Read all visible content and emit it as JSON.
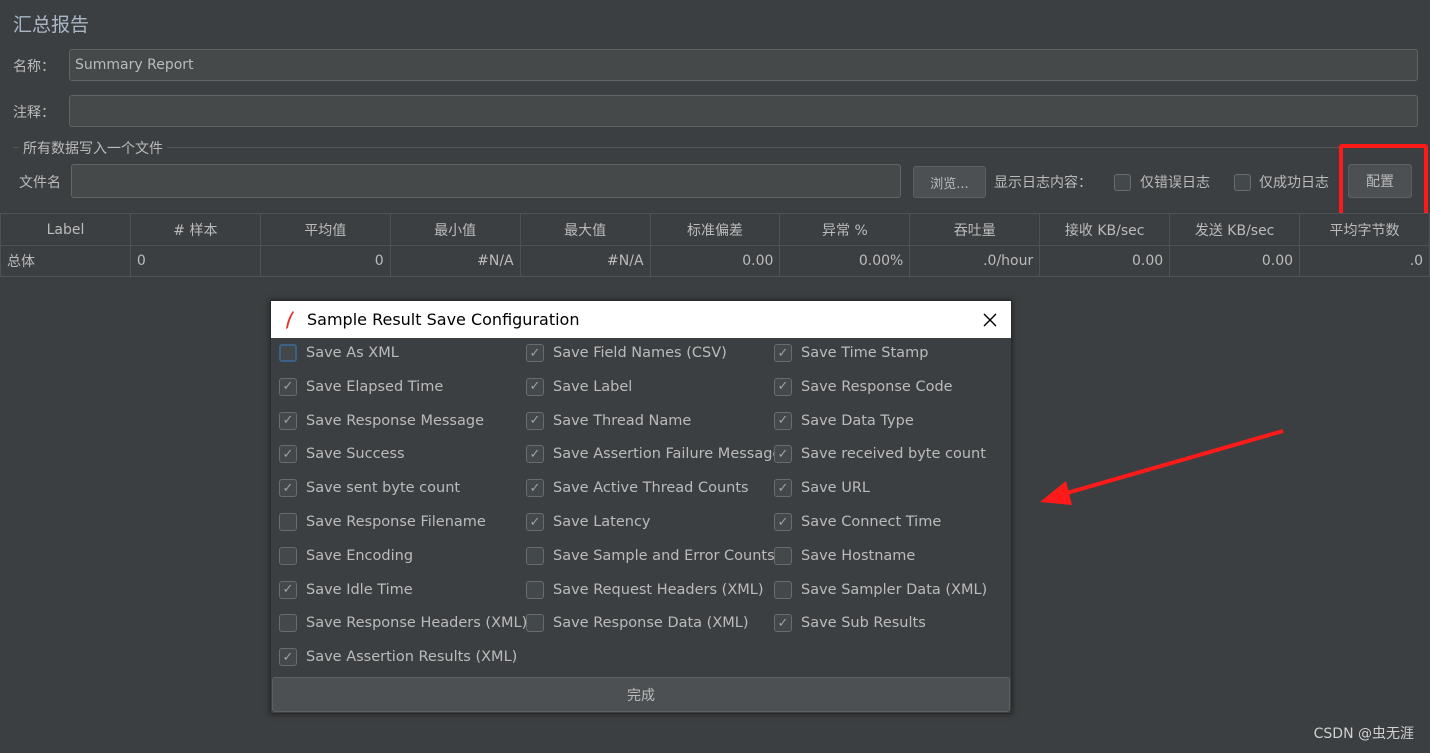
{
  "header": {
    "title": "汇总报告",
    "name_label": "名称：",
    "name_value": "Summary Report",
    "comment_label": "注释：",
    "comment_value": ""
  },
  "file": {
    "group_label": "所有数据写入一个文件",
    "filename_label": "文件名",
    "filename_value": "",
    "browse_label": "浏览...",
    "log_label": "显示日志内容：",
    "errors_only": "仅错误日志",
    "success_only": "仅成功日志",
    "configure_label": "配置"
  },
  "table": {
    "columns": [
      "Label",
      "# 样本",
      "平均值",
      "最小值",
      "最大值",
      "标准偏差",
      "异常 %",
      "吞吐量",
      "接收 KB/sec",
      "发送 KB/sec",
      "平均字节数"
    ],
    "rows": [
      [
        "总体",
        "0",
        "0",
        "#N/A",
        "#N/A",
        "0.00",
        "0.00%",
        ".0/hour",
        "0.00",
        "0.00",
        ".0"
      ]
    ]
  },
  "dialog": {
    "title": "Sample Result Save Configuration",
    "close_icon": "close-icon",
    "app_icon": "jmeter-feather-icon",
    "done_label": "完成",
    "columns": [
      [
        {
          "label": "Save As XML",
          "checked": false
        },
        {
          "label": "Save Elapsed Time",
          "checked": true
        },
        {
          "label": "Save Response Message",
          "checked": true
        },
        {
          "label": "Save Success",
          "checked": true
        },
        {
          "label": "Save sent byte count",
          "checked": true
        },
        {
          "label": "Save Response Filename",
          "checked": false
        },
        {
          "label": "Save Encoding",
          "checked": false
        },
        {
          "label": "Save Idle Time",
          "checked": true
        },
        {
          "label": "Save Response Headers (XML)",
          "checked": false
        },
        {
          "label": "Save Assertion Results (XML)",
          "checked": true
        }
      ],
      [
        {
          "label": "Save Field Names (CSV)",
          "checked": true
        },
        {
          "label": "Save Label",
          "checked": true
        },
        {
          "label": "Save Thread Name",
          "checked": true
        },
        {
          "label": "Save Assertion Failure Message",
          "checked": true
        },
        {
          "label": "Save Active Thread Counts",
          "checked": true
        },
        {
          "label": "Save Latency",
          "checked": true
        },
        {
          "label": "Save Sample and Error Counts",
          "checked": false
        },
        {
          "label": "Save Request Headers (XML)",
          "checked": false
        },
        {
          "label": "Save Response Data (XML)",
          "checked": false
        }
      ],
      [
        {
          "label": "Save Time Stamp",
          "checked": true
        },
        {
          "label": "Save Response Code",
          "checked": true
        },
        {
          "label": "Save Data Type",
          "checked": true
        },
        {
          "label": "Save received byte count",
          "checked": true
        },
        {
          "label": "Save URL",
          "checked": true
        },
        {
          "label": "Save Connect Time",
          "checked": true
        },
        {
          "label": "Save Hostname",
          "checked": false
        },
        {
          "label": "Save Sampler Data (XML)",
          "checked": false
        },
        {
          "label": "Save Sub Results",
          "checked": true
        }
      ]
    ]
  },
  "annotation_color": "#ff1a1a",
  "watermark": "CSDN @虫无涯"
}
